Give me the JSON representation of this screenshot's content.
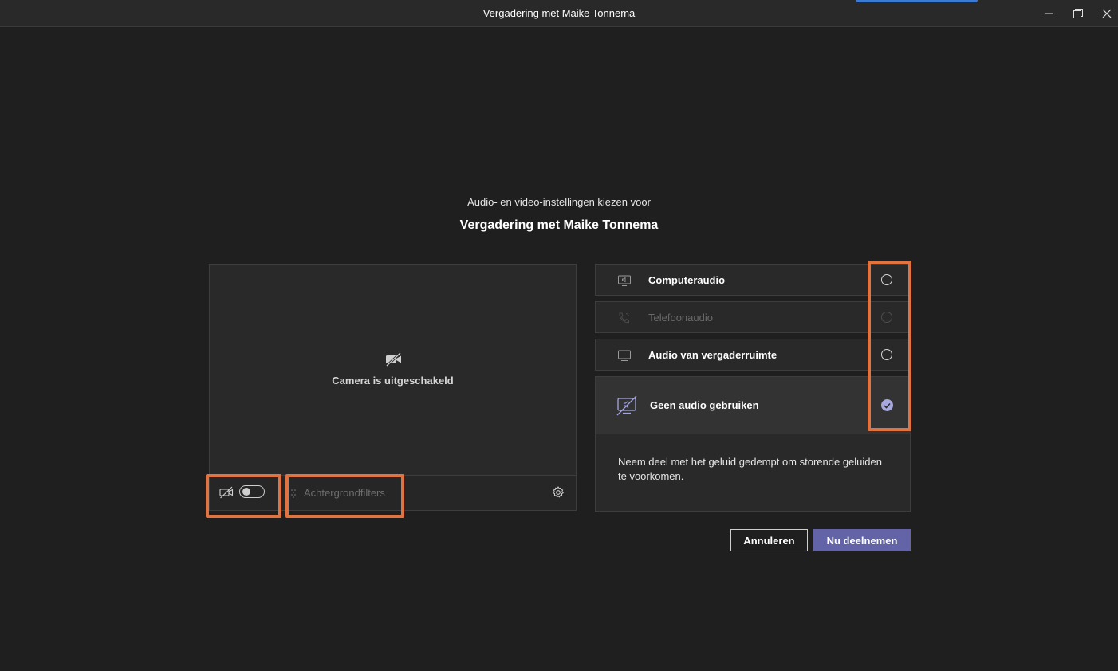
{
  "window": {
    "title": "Vergadering met Maike Tonnema"
  },
  "prejoin": {
    "subtitle": "Audio- en video-instellingen kiezen voor",
    "meeting_title": "Vergadering met Maike Tonnema"
  },
  "video": {
    "camera_off_text": "Camera is uitgeschakeld",
    "camera_toggle_on": false,
    "background_filters_label": "Achtergrondfilters"
  },
  "audio_options": [
    {
      "label": "Computeraudio",
      "icon": "computer-audio-icon",
      "selected": false,
      "disabled": false
    },
    {
      "label": "Telefoonaudio",
      "icon": "phone-audio-icon",
      "selected": false,
      "disabled": true
    },
    {
      "label": "Audio van vergaderruimte",
      "icon": "room-audio-icon",
      "selected": false,
      "disabled": false
    },
    {
      "label": "Geen audio gebruiken",
      "icon": "no-audio-icon",
      "selected": true,
      "disabled": false
    }
  ],
  "audio_description": "Neem deel met het geluid gedempt om storende geluiden te voorkomen.",
  "buttons": {
    "cancel": "Annuleren",
    "join": "Nu deelnemen"
  },
  "colors": {
    "accent": "#6264a7",
    "highlight": "#e0733f",
    "background": "#1f1f1f"
  }
}
